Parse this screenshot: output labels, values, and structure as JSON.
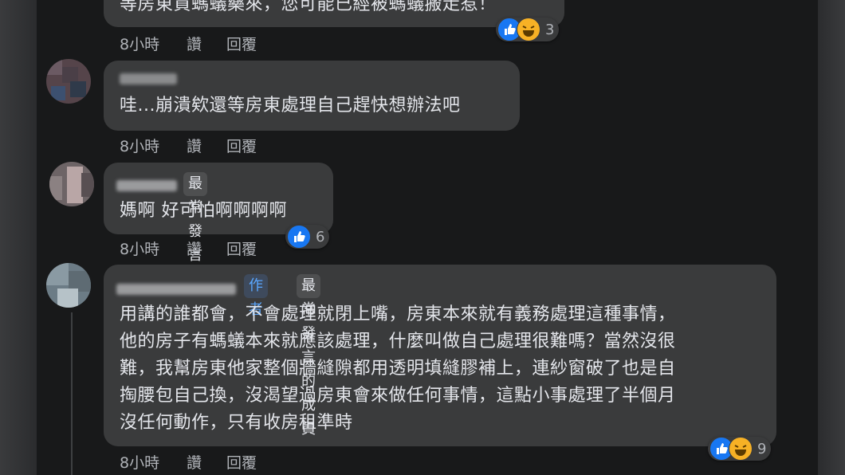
{
  "comments": [
    {
      "text": "等房東買螞蟻藥來，您可能已經被螞蟻搬走惹！",
      "time": "8小時",
      "like_label": "讚",
      "reply_label": "回覆",
      "reaction_count": "3"
    },
    {
      "name": "瀏覽者",
      "text": "哇...崩潰欸還等房東處理自己趕快想辦法吧",
      "time": "8小時",
      "like_label": "讚",
      "reply_label": "回覆"
    },
    {
      "badge": "最常發言的成員",
      "text": "媽啊 好可怕啊啊啊啊",
      "time": "8小時",
      "like_label": "讚",
      "reply_label": "回覆",
      "reaction_count": "6"
    },
    {
      "author_badge": "作者",
      "badge": "最常發言的成員",
      "lines": [
        "用講的誰都會，不會處理就閉上嘴，房東本來就有義務處理這種事情，",
        "他的房子有螞蟻本來就應該處理，什麼叫做自己處理很難嗎？當然沒很",
        "難，我幫房東他家整個牆縫隙都用透明填縫膠補上，連紗窗破了也是自",
        "掏腰包自己換，沒渴望過房東會來做任何事情，這點小事處理了半個月",
        "沒任何動作，只有收房租準時"
      ],
      "time": "8小時",
      "like_label": "讚",
      "reply_label": "回覆",
      "reaction_count": "9"
    }
  ],
  "colors": {
    "bubble": "#3a3b3c",
    "background": "#18191a",
    "like": "#1877f2",
    "haha": "#f7b125",
    "author": "#5aa7ff"
  }
}
